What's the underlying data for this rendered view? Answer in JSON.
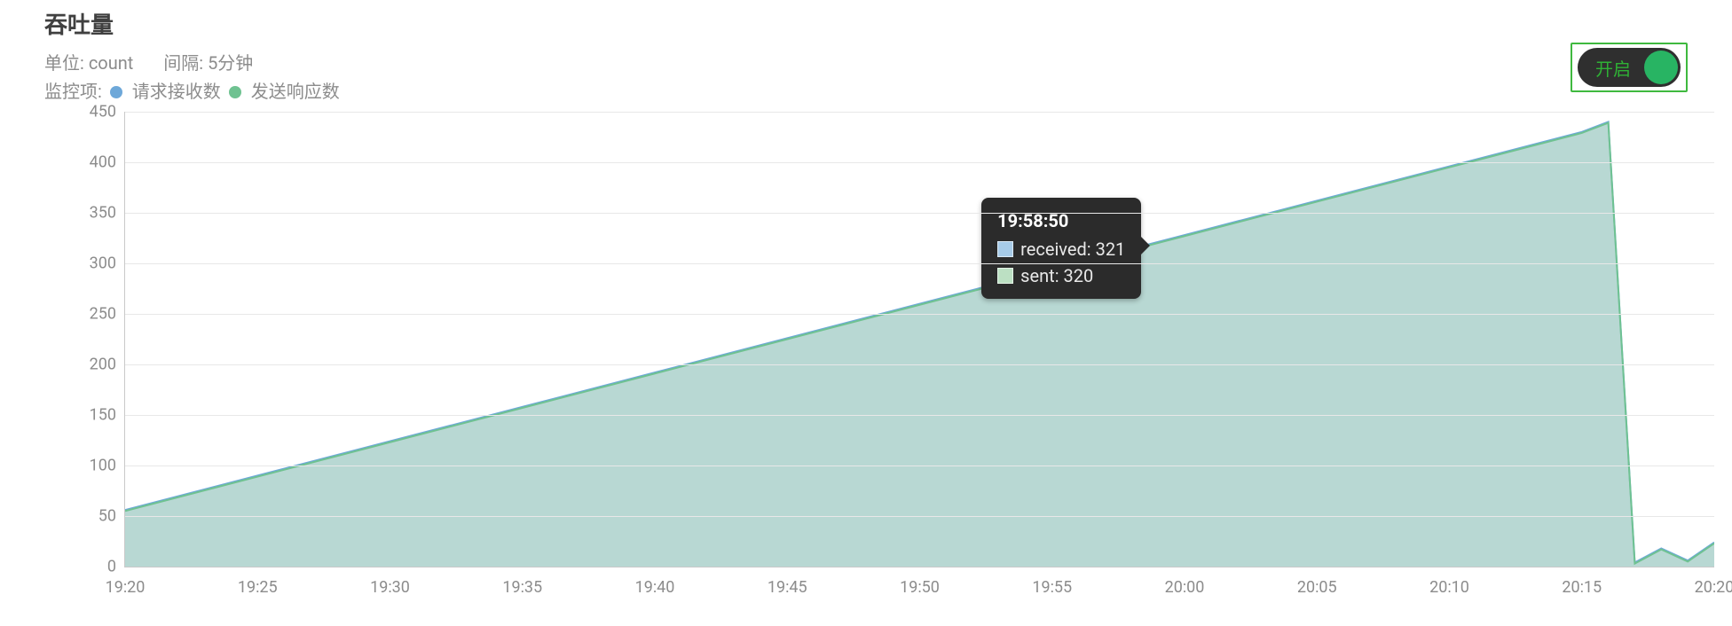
{
  "header": {
    "title": "吞吐量",
    "unit_label": "单位:",
    "unit_value": "count",
    "interval_label": "间隔:",
    "interval_value": "5分钟",
    "monitor_label": "监控项:",
    "series1_label": "请求接收数",
    "series2_label": "发送响应数"
  },
  "toggle": {
    "label": "开启",
    "state": "on"
  },
  "tooltip": {
    "time": "19:58:50",
    "items": [
      {
        "label": "received",
        "value": "321",
        "color": "blue"
      },
      {
        "label": "sent",
        "value": "320",
        "color": "green"
      }
    ]
  },
  "chart_data": {
    "type": "area",
    "title": "吞吐量",
    "xlabel": "",
    "ylabel": "",
    "ylim": [
      0,
      450
    ],
    "y_ticks": [
      0,
      50,
      100,
      150,
      200,
      250,
      300,
      350,
      400,
      450
    ],
    "x_ticks": [
      "19:20",
      "19:25",
      "19:30",
      "19:35",
      "19:40",
      "19:45",
      "19:50",
      "19:55",
      "20:00",
      "20:05",
      "20:10",
      "20:15",
      "20:20"
    ],
    "x": [
      "19:20",
      "19:25",
      "19:30",
      "19:35",
      "19:40",
      "19:45",
      "19:50",
      "19:55",
      "20:00",
      "20:05",
      "20:10",
      "20:15",
      "20:16",
      "20:17",
      "20:18",
      "20:19",
      "20:20"
    ],
    "series": [
      {
        "name": "请求接收数 (received)",
        "color": "#6ea8d9",
        "values": [
          56,
          90,
          124,
          158,
          192,
          226,
          260,
          294,
          328,
          362,
          396,
          430,
          440,
          4,
          18,
          6,
          24
        ]
      },
      {
        "name": "发送响应数 (sent)",
        "color": "#6fc291",
        "values": [
          55,
          89,
          123,
          157,
          191,
          225,
          259,
          293,
          327,
          361,
          395,
          429,
          439,
          3,
          17,
          5,
          23
        ]
      }
    ],
    "hover_point": {
      "x": "19:58:50",
      "received": 321,
      "sent": 320
    }
  }
}
